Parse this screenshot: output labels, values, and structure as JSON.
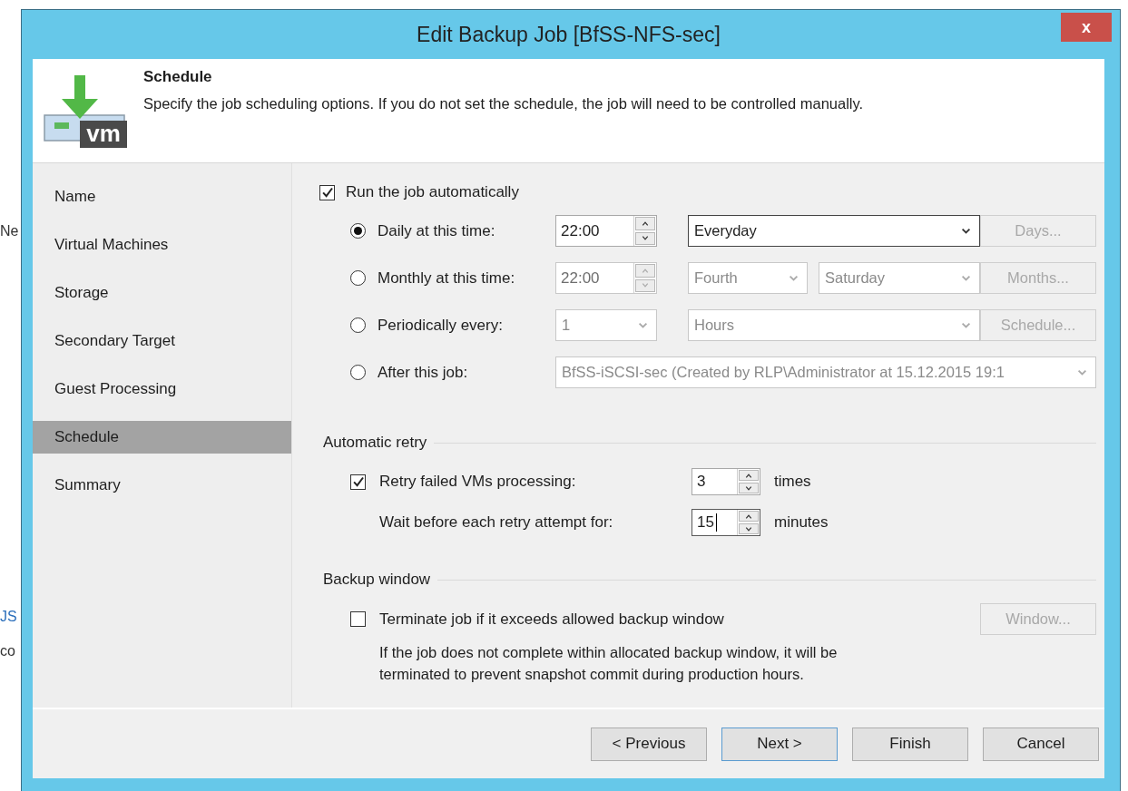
{
  "background_window": {
    "fragments": [
      {
        "text": "Ne",
        "kind": "plain"
      },
      {
        "text": "JS",
        "kind": "link"
      },
      {
        "text": "co",
        "kind": "plain"
      }
    ]
  },
  "window": {
    "title": "Edit Backup Job [BfSS-NFS-sec]",
    "close_label": "x"
  },
  "header": {
    "logo_text": "vm",
    "title": "Schedule",
    "description": "Specify the job scheduling options. If you do not set the schedule, the job will need to be controlled manually."
  },
  "steps": [
    {
      "label": "Name",
      "selected": false
    },
    {
      "label": "Virtual Machines",
      "selected": false
    },
    {
      "label": "Storage",
      "selected": false
    },
    {
      "label": "Secondary Target",
      "selected": false
    },
    {
      "label": "Guest Processing",
      "selected": false
    },
    {
      "label": "Schedule",
      "selected": true
    },
    {
      "label": "Summary",
      "selected": false
    }
  ],
  "run_automatically": {
    "label": "Run the job automatically",
    "checked": true
  },
  "schedule_options": [
    {
      "label": "Daily at this time:",
      "selected": true,
      "fields": [
        {
          "kind": "spin",
          "value": "22:00",
          "focused": false
        },
        {
          "kind": "dropdown",
          "value": "Everyday",
          "focused": true
        }
      ],
      "button": {
        "label": "Days...",
        "disabled": true
      }
    },
    {
      "label": "Monthly at this time:",
      "selected": false,
      "fields": [
        {
          "kind": "spin",
          "value": "22:00",
          "focused": false
        },
        {
          "kind": "dropdown",
          "value": "Fourth",
          "focused": false
        },
        {
          "kind": "dropdown",
          "value": "Saturday",
          "focused": false
        }
      ],
      "button": {
        "label": "Months...",
        "disabled": true
      }
    },
    {
      "label": "Periodically every:",
      "selected": false,
      "fields": [
        {
          "kind": "dropdown",
          "value": "1",
          "focused": false
        },
        {
          "kind": "dropdown",
          "value": "Hours",
          "focused": false
        }
      ],
      "button": {
        "label": "Schedule...",
        "disabled": true
      }
    },
    {
      "label": "After this job:",
      "selected": false,
      "fields": [
        {
          "kind": "dropdown",
          "value": "BfSS-iSCSI-sec (Created by RLP\\Administrator at 15.12.2015 19:1",
          "focused": false
        }
      ]
    }
  ],
  "retry": {
    "title": "Automatic retry",
    "rows": [
      {
        "kind": "checkbox",
        "label": "Retry failed VMs processing:",
        "checked": true,
        "value": "3",
        "unit": "times",
        "focused": false
      },
      {
        "kind": "plain",
        "label": "Wait before each retry attempt for:",
        "value": "15",
        "unit": "minutes",
        "focused": true
      }
    ]
  },
  "backup_window": {
    "title": "Backup window",
    "option": {
      "label": "Terminate job if it exceeds allowed backup window",
      "checked": false
    },
    "button": {
      "label": "Window...",
      "disabled": true
    },
    "note": "If the job does not complete within allocated backup window, it will be terminated to prevent snapshot commit during production hours."
  },
  "footer_buttons": [
    {
      "label": "< Previous",
      "default": false
    },
    {
      "label": "Next >",
      "default": true
    },
    {
      "label": "Finish",
      "default": false
    },
    {
      "label": "Cancel",
      "default": false
    }
  ]
}
